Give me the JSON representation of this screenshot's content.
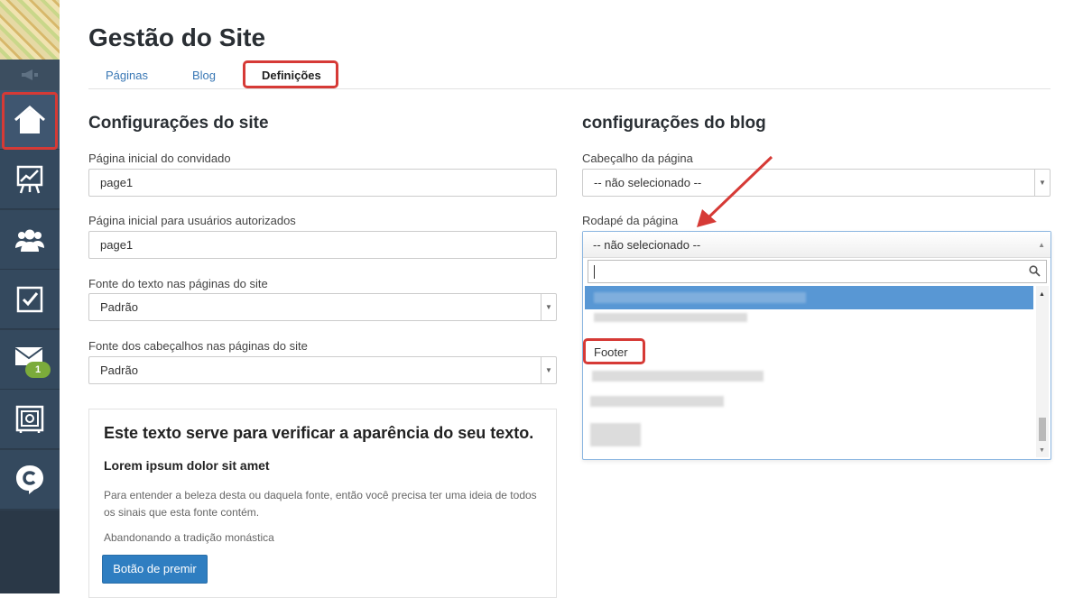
{
  "header": {
    "title": "Gestão do Site"
  },
  "tabs": [
    {
      "label": "Páginas"
    },
    {
      "label": "Blog"
    },
    {
      "label": "Definições",
      "active": true
    }
  ],
  "sidebar": {
    "items": [
      {
        "icon": "home-icon",
        "active": true
      },
      {
        "icon": "chart-board-icon"
      },
      {
        "icon": "users-icon"
      },
      {
        "icon": "checkbox-icon"
      },
      {
        "icon": "mail-icon",
        "badge": "1"
      },
      {
        "icon": "safe-icon"
      },
      {
        "icon": "logo-c-icon"
      }
    ]
  },
  "site_settings": {
    "heading": "Configurações do site",
    "guest_home": {
      "label": "Página inicial do convidado",
      "value": "page1"
    },
    "auth_home": {
      "label": "Página inicial para usuários autorizados",
      "value": "page1"
    },
    "text_font": {
      "label": "Fonte do texto nas páginas do site",
      "value": "Padrão"
    },
    "heading_font": {
      "label": "Fonte dos cabeçalhos nas páginas do site",
      "value": "Padrão"
    }
  },
  "preview": {
    "heading": "Este texto serve para verificar a aparência do seu texto.",
    "subheading": "Lorem ipsum dolor sit amet",
    "paragraph": "Para entender a beleza desta ou daquela fonte, então você precisa ter uma ideia de todos os sinais que esta fonte contém.",
    "paragraph2": "Abandonando a tradição monástica",
    "button_label": "Botão de premir"
  },
  "blog_settings": {
    "heading": "configurações do blog",
    "page_header": {
      "label": "Cabeçalho da página",
      "value": "-- não selecionado --"
    },
    "page_footer": {
      "label": "Rodapé da página",
      "value": "-- não selecionado --",
      "search_value": "",
      "visible_option": "Footer"
    }
  },
  "colors": {
    "accent": "#3a78b5",
    "annotation_red": "#d63a36",
    "sidebar": "#2e3e4e",
    "highlight": "#5897d4",
    "button": "#2f7ec1"
  }
}
